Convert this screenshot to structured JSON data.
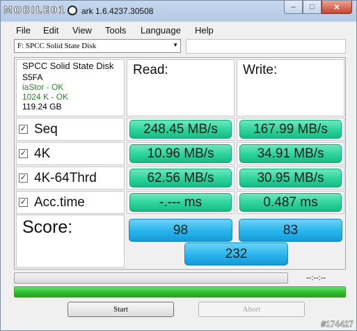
{
  "window": {
    "logo": "MOBILE01",
    "title": "ark 1.6.4237.30508",
    "controls": {
      "minimize": "–",
      "maximize": "□",
      "close": "✕"
    }
  },
  "menu": [
    "File",
    "Edit",
    "View",
    "Tools",
    "Language",
    "Help"
  ],
  "drive": {
    "selected": "F: SPCC Solid State Disk",
    "extra": ""
  },
  "info": {
    "name": "SPCC Solid State Disk",
    "firmware": "S5FA",
    "driver": "iaStor - OK",
    "alignment": "1024 K - OK",
    "size": "119.24 GB"
  },
  "headers": {
    "read": "Read:",
    "write": "Write:"
  },
  "tests": [
    {
      "label": "Seq",
      "checked": "✓",
      "read": "248.45 MB/s",
      "write": "167.99 MB/s"
    },
    {
      "label": "4K",
      "checked": "✓",
      "read": "10.96 MB/s",
      "write": "34.91 MB/s"
    },
    {
      "label": "4K-64Thrd",
      "checked": "✓",
      "read": "62.56 MB/s",
      "write": "30.95 MB/s"
    },
    {
      "label": "Acc.time",
      "checked": "✓",
      "read": "-.--- ms",
      "write": "0.487 ms"
    }
  ],
  "score": {
    "label": "Score:",
    "read": "98",
    "write": "83",
    "total": "232"
  },
  "progress": {
    "time": "--:--:--",
    "main_fill": 1.0
  },
  "buttons": {
    "start": "Start",
    "abort": "Abort"
  },
  "watermark": "#174427",
  "colors": {
    "result_green": "#2bd39a",
    "score_blue": "#27b4eb",
    "progress_green": "#2fbf2f"
  }
}
